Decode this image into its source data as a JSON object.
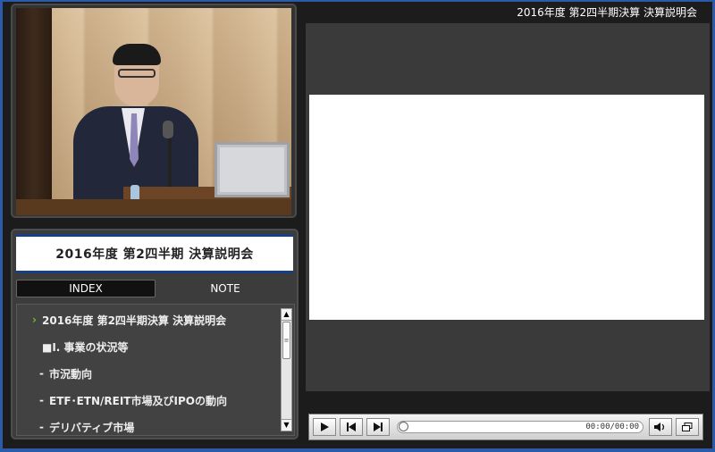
{
  "header": {
    "title": "2016年度 第2四半期決算 決算説明会"
  },
  "index_panel": {
    "title": "2016年度  第2四半期  決算説明会",
    "tabs": [
      {
        "label": "INDEX"
      },
      {
        "label": "NOTE"
      }
    ],
    "items": [
      {
        "marker": "›",
        "label": "2016年度 第2四半期決算 決算説明会",
        "active": true
      },
      {
        "marker": "",
        "label": "■I. 事業の状況等"
      },
      {
        "marker": "-",
        "label": "市況動向"
      },
      {
        "marker": "-",
        "label": "ETF･ETN/REIT市場及びIPOの動向"
      },
      {
        "marker": "-",
        "label": "デリバティブ市場"
      }
    ]
  },
  "player": {
    "time": "00:00/00:00",
    "icons": [
      "play-icon",
      "previous-icon",
      "next-icon",
      "volume-icon",
      "window-icon"
    ]
  }
}
